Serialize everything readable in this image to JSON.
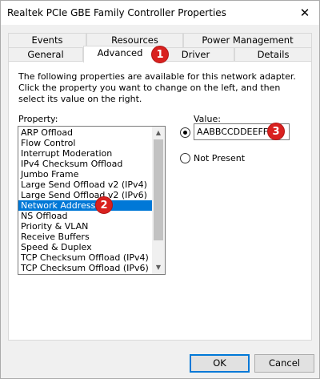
{
  "window": {
    "title": "Realtek PCIe GBE Family Controller Properties",
    "close_glyph": "✕"
  },
  "tabs": {
    "back_row": [
      "Events",
      "Resources",
      "Power Management"
    ],
    "front_row": [
      "General",
      "Advanced",
      "Driver",
      "Details"
    ],
    "active": "Advanced"
  },
  "advanced": {
    "description": "The following properties are available for this network adapter. Click the property you want to change on the left, and then select its value on the right.",
    "property_label": "Property:",
    "value_label": "Value:",
    "properties": [
      "ARP Offload",
      "Flow Control",
      "Interrupt Moderation",
      "IPv4 Checksum Offload",
      "Jumbo Frame",
      "Large Send Offload v2 (IPv4)",
      "Large Send Offload v2 (IPv6)",
      "Network Address",
      "NS Offload",
      "Priority & VLAN",
      "Receive Buffers",
      "Speed & Duplex",
      "TCP Checksum Offload (IPv4)",
      "TCP Checksum Offload (IPv6)"
    ],
    "selected_property": "Network Address",
    "value": "AABBCCDDEEFF",
    "value_radio_selected": true,
    "not_present_label": "Not Present",
    "scroll_up_glyph": "▲",
    "scroll_down_glyph": "▼"
  },
  "annotations": [
    "1",
    "2",
    "3"
  ],
  "buttons": {
    "ok": "OK",
    "cancel": "Cancel"
  },
  "colors": {
    "selection": "#0078d7",
    "badge": "#d9211f",
    "default_button_border": "#0078d7"
  }
}
